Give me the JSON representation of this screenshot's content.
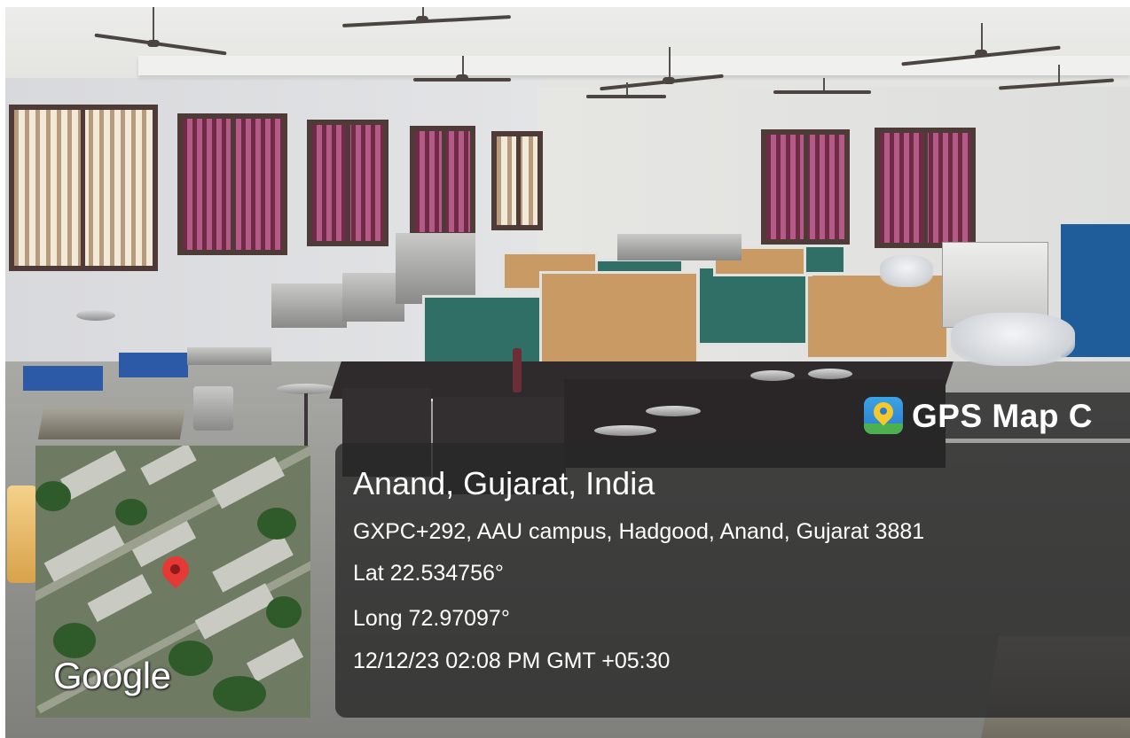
{
  "scene": {
    "description_icon": "photo-background"
  },
  "badge": {
    "app_name": "GPS Map C",
    "icon": "gps-map-camera-app-icon"
  },
  "location": {
    "title": "Anand, Gujarat, India",
    "address": "GXPC+292, AAU campus, Hadgood, Anand, Gujarat 3881",
    "latitude": "Lat 22.534756°",
    "longitude": "Long 72.97097°",
    "timestamp": "12/12/23 02:08 PM GMT +05:30"
  },
  "map": {
    "attribution": "Google",
    "marker_icon": "location-pin-icon",
    "marker_color": "#e53935"
  },
  "colors": {
    "overlay": "#282828",
    "text": "#ffffff"
  }
}
